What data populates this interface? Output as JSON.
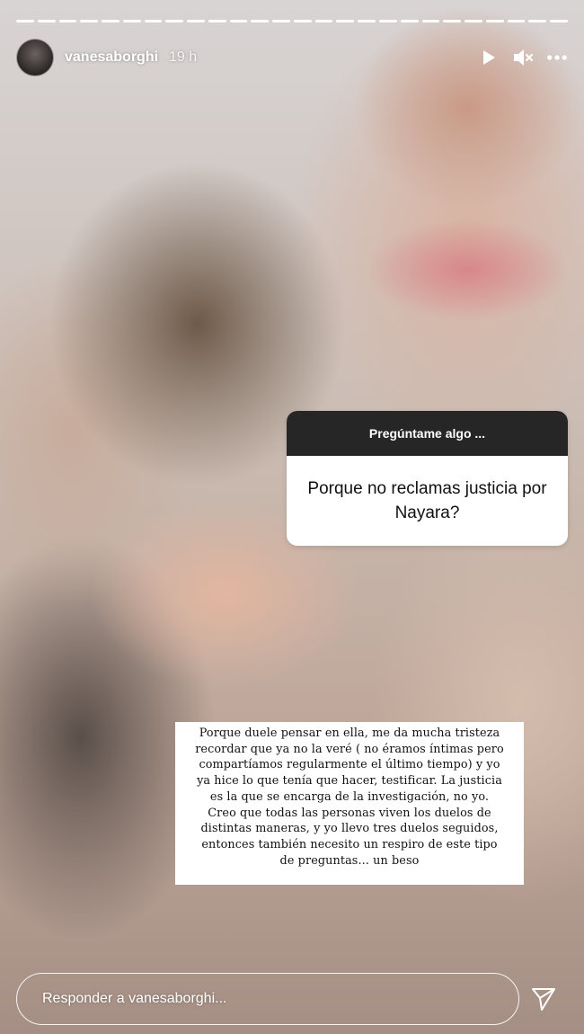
{
  "header": {
    "username": "vanesaborghi",
    "time": "19 h"
  },
  "progress_segments": 26,
  "icons": {
    "play": "play-icon",
    "mute": "muted-speaker-icon",
    "more": "more-options-icon",
    "send": "send-icon"
  },
  "question_sticker": {
    "header": "Pregúntame algo ...",
    "question": "Porque no reclamas justicia por Nayara?"
  },
  "answer": {
    "lines": [
      "Porque duele pensar en ella, me da mucha tristeza",
      "recordar que ya no la veré ( no éramos íntimas pero",
      "compartíamos regularmente el último tiempo) y yo",
      "ya hice lo que tenía que hacer, testificar. La justicia",
      "es la que se encarga de la investigación, no yo.",
      "Creo que todas las personas viven los duelos de",
      "distintas maneras, y yo llevo tres duelos seguidos,",
      "entonces también necesito un respiro de este tipo",
      "de preguntas... un beso"
    ]
  },
  "reply": {
    "placeholder": "Responder a vanesaborghi..."
  }
}
